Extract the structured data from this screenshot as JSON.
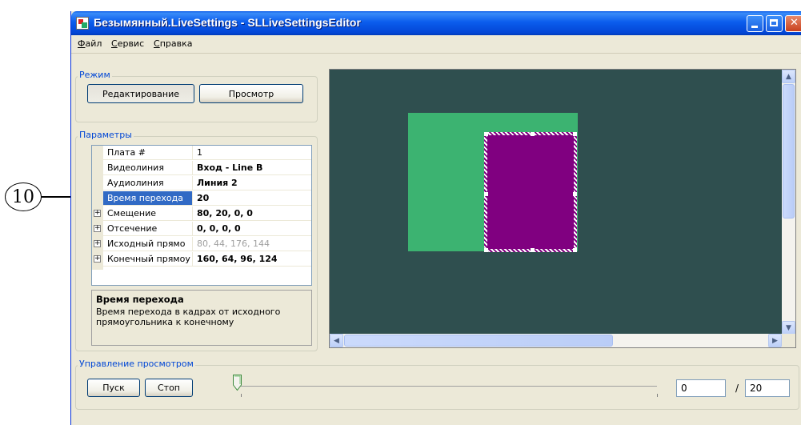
{
  "callout": {
    "number": "10"
  },
  "window": {
    "title": "Безымянный.LiveSettings - SLLiveSettingsEditor"
  },
  "menu": [
    "Файл",
    "Сервис",
    "Справка"
  ],
  "mode": {
    "label": "Режим",
    "edit_button": "Редактирование",
    "view_button": "Просмотр"
  },
  "params": {
    "label": "Параметры",
    "rows": [
      {
        "name": "Плата #",
        "value": "1",
        "expander": false,
        "style": "normal"
      },
      {
        "name": "Видеолиния",
        "value": "Вход - Line B",
        "expander": false,
        "style": "bold"
      },
      {
        "name": "Аудиолиния",
        "value": "Линия 2",
        "expander": false,
        "style": "bold"
      },
      {
        "name": "Время перехода",
        "value": "20",
        "expander": false,
        "style": "bold"
      },
      {
        "name": "Смещение",
        "value": "80, 20, 0, 0",
        "expander": true,
        "style": "bold"
      },
      {
        "name": "Отсечение",
        "value": "0, 0, 0, 0",
        "expander": true,
        "style": "bold"
      },
      {
        "name": "Исходный прямо",
        "value": "80, 44, 176, 144",
        "expander": true,
        "style": "gray"
      },
      {
        "name": "Конечный прямоу",
        "value": "160, 64, 96, 124",
        "expander": true,
        "style": "bold"
      }
    ],
    "selected_index": 3,
    "description": {
      "title": "Время перехода",
      "text": "Время перехода в кадрах от исходного прямоугольника к конечному"
    }
  },
  "preview": {
    "label": "Управление просмотром",
    "play_button": "Пуск",
    "stop_button": "Стоп",
    "current_frame": "0",
    "separator": "/",
    "total_frames": "20",
    "slider_position": 0
  },
  "colors": {
    "canvas_bg": "#2f4f4f",
    "source_rect": "#3cb371",
    "target_rect": "#800080",
    "group_label": "#0046d5",
    "selection": "#316ac5"
  }
}
